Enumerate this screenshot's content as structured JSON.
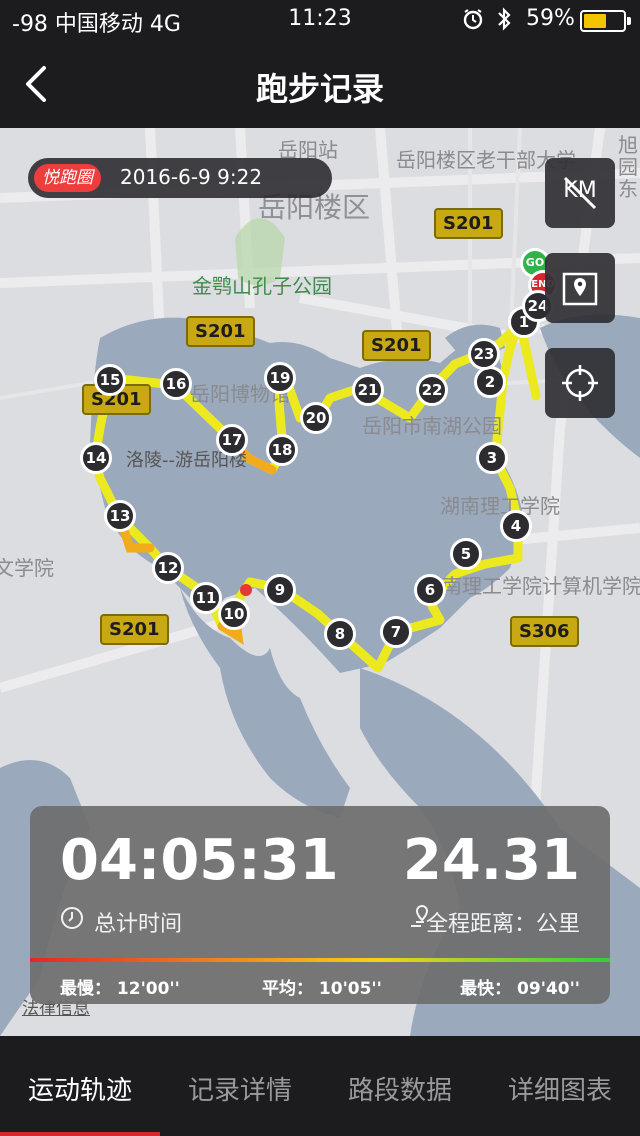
{
  "status_bar": {
    "carrier": "-98 中国移动  4G",
    "time": "11:23",
    "battery_percent": "59%",
    "battery_level": 0.59,
    "alarm_icon": "alarm-icon",
    "bluetooth_icon": "bluetooth-icon"
  },
  "nav": {
    "title": "跑步记录",
    "back_icon": "chevron-left-icon"
  },
  "map": {
    "brand_tag": "悦跑圈",
    "date": "2016-6-9 9:22",
    "places": {
      "station": "岳阳站",
      "district": "岳阳楼区",
      "cadre_univ": "岳阳楼区老干部大学",
      "park": "金鹗山孔子公园",
      "museum": "岳阳博物馆",
      "nanhu_park": "岳阳市南湖公园",
      "lake_road": "洛陵--游岳阳楼",
      "hunan_inst": "湖南理工学院",
      "hunan_cs": "湖南理工学院计算机学院",
      "xueyuan_left": "文学院",
      "xuyuan_right": "旭园东"
    },
    "roads": [
      "S201",
      "S201",
      "S201",
      "S201",
      "S201",
      "S306"
    ],
    "buttons": {
      "km_toggle": "KM",
      "km_icon": "km-off-icon",
      "map_icon": "map-pin-icon",
      "locate_icon": "crosshair-icon"
    },
    "start_label": "GO",
    "end_label": "END",
    "markers": [
      "1",
      "2",
      "3",
      "4",
      "5",
      "6",
      "7",
      "8",
      "9",
      "10",
      "11",
      "12",
      "13",
      "14",
      "15",
      "16",
      "17",
      "18",
      "19",
      "20",
      "21",
      "22",
      "23",
      "24"
    ],
    "legal_text": "法律信息"
  },
  "stats": {
    "duration": "04:05:31",
    "duration_label": "总计时间",
    "distance": "24.31",
    "distance_label": "全程距离：公里",
    "pace_slowest": "最慢：  12'00''",
    "pace_average": "平均：  10'05''",
    "pace_fastest": "最快：  09'40''",
    "clock_icon": "clock-icon",
    "route_icon": "route-icon"
  },
  "tabs": [
    {
      "label": "运动轨迹",
      "active": true
    },
    {
      "label": "记录详情",
      "active": false
    },
    {
      "label": "路段数据",
      "active": false
    },
    {
      "label": "详细图表",
      "active": false
    }
  ],
  "colors": {
    "route": "#ecea1e",
    "route_slow": "#f2ab1b",
    "water": "#9ba9bd",
    "brand_red": "#d8262c"
  }
}
